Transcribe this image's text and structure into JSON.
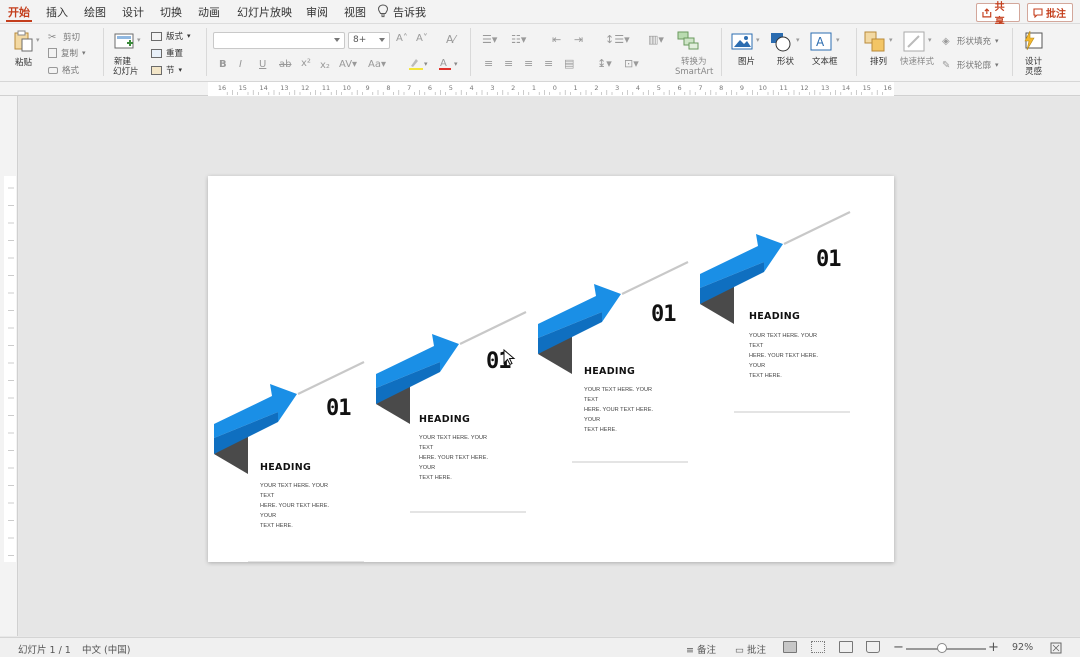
{
  "tabs": [
    {
      "label": "开始",
      "active": true
    },
    {
      "label": "插入"
    },
    {
      "label": "绘图"
    },
    {
      "label": "设计"
    },
    {
      "label": "切换"
    },
    {
      "label": "动画"
    },
    {
      "label": "幻灯片放映"
    },
    {
      "label": "审阅"
    },
    {
      "label": "视图"
    }
  ],
  "tell_me": "告诉我",
  "share_label": "共享",
  "comment_label": "批注",
  "ribbon": {
    "paste": "粘贴",
    "cut": "剪切",
    "copy": "复制",
    "format": "格式",
    "new_slide_1": "新建",
    "new_slide_2": "幻灯片",
    "layout": "版式",
    "reset": "重置",
    "section": "节",
    "font_size": "8+",
    "convert_1": "转换为",
    "convert_2": "SmartArt",
    "picture": "图片",
    "shape": "形状",
    "textbox": "文本框",
    "arrange": "排列",
    "quick_styles": "快速样式",
    "shape_fill": "形状填充",
    "shape_outline": "形状轮廓",
    "design_1": "设计",
    "design_2": "灵感"
  },
  "ruler_numbers": [
    "16",
    "15",
    "14",
    "13",
    "12",
    "11",
    "10",
    "9",
    "8",
    "7",
    "6",
    "5",
    "4",
    "3",
    "2",
    "1",
    "0",
    "1",
    "2",
    "3",
    "4",
    "5",
    "6",
    "7",
    "8",
    "9",
    "10",
    "11",
    "12",
    "13",
    "14",
    "15",
    "16"
  ],
  "slide": {
    "steps": [
      {
        "number": "01",
        "heading": "HEADING",
        "body_lines": [
          "YOUR TEXT HERE. YOUR TEXT",
          "HERE. YOUR TEXT HERE. YOUR",
          "TEXT HERE."
        ]
      },
      {
        "number": "01",
        "heading": "HEADING",
        "body_lines": [
          "YOUR TEXT HERE. YOUR TEXT",
          "HERE. YOUR TEXT HERE. YOUR",
          "TEXT HERE."
        ]
      },
      {
        "number": "01",
        "heading": "HEADING",
        "body_lines": [
          "YOUR TEXT HERE. YOUR TEXT",
          "HERE. YOUR TEXT HERE. YOUR",
          "TEXT HERE."
        ]
      },
      {
        "number": "01",
        "heading": "HEADING",
        "body_lines": [
          "YOUR TEXT HERE. YOUR TEXT",
          "HERE. YOUR TEXT HERE. YOUR",
          "TEXT HERE."
        ]
      }
    ],
    "colors": {
      "arrow_light": "#1a8fe6",
      "arrow_dark": "#0f6fc0",
      "fold": "#4a4a4a",
      "line": "#c8c8c8"
    }
  },
  "status": {
    "slide_count": "幻灯片 1 / 1",
    "language": "中文 (中国)",
    "notes": "备注",
    "comments": "批注",
    "zoom": "92%"
  }
}
